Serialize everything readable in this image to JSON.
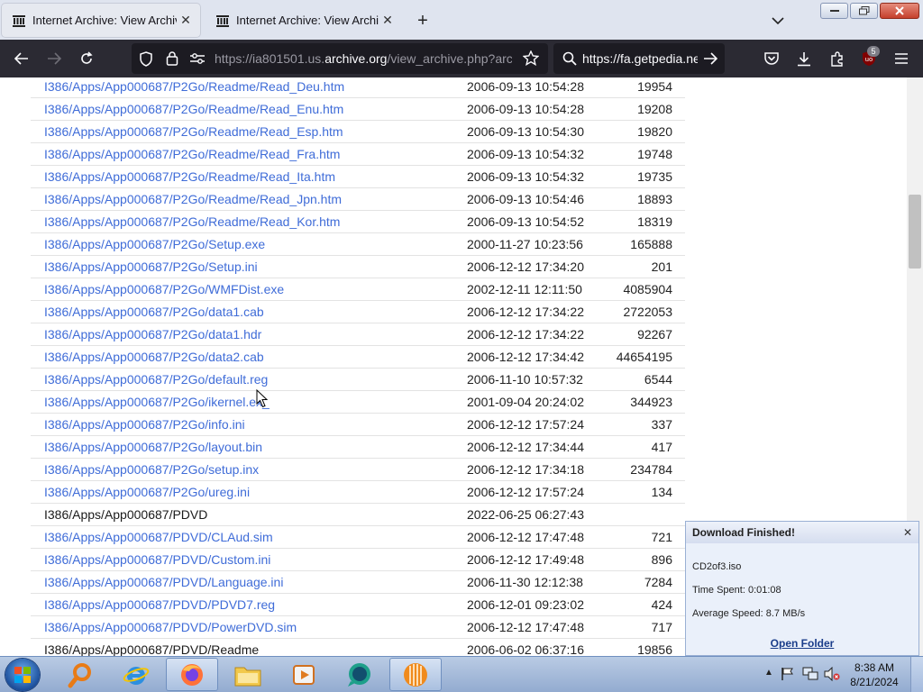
{
  "browser": {
    "tabs": [
      {
        "title": "Internet Archive: View Archive",
        "active": true
      },
      {
        "title": "Internet Archive: View Archive",
        "active": false
      }
    ],
    "url_host_prefix": "https://ia801501.us.",
    "url_host_main": "archive.org",
    "url_path": "/view_archive.php?archi",
    "search_text": "https://fa.getpedia.ne",
    "extension_badge": "5"
  },
  "files": [
    {
      "name": "I386/Apps/App000687/P2Go/Readme/Read_Deu.htm",
      "date": "2006-09-13 10:54:28",
      "size": "19954",
      "link": true
    },
    {
      "name": "I386/Apps/App000687/P2Go/Readme/Read_Enu.htm",
      "date": "2006-09-13 10:54:28",
      "size": "19208",
      "link": true
    },
    {
      "name": "I386/Apps/App000687/P2Go/Readme/Read_Esp.htm",
      "date": "2006-09-13 10:54:30",
      "size": "19820",
      "link": true
    },
    {
      "name": "I386/Apps/App000687/P2Go/Readme/Read_Fra.htm",
      "date": "2006-09-13 10:54:32",
      "size": "19748",
      "link": true
    },
    {
      "name": "I386/Apps/App000687/P2Go/Readme/Read_Ita.htm",
      "date": "2006-09-13 10:54:32",
      "size": "19735",
      "link": true
    },
    {
      "name": "I386/Apps/App000687/P2Go/Readme/Read_Jpn.htm",
      "date": "2006-09-13 10:54:46",
      "size": "18893",
      "link": true
    },
    {
      "name": "I386/Apps/App000687/P2Go/Readme/Read_Kor.htm",
      "date": "2006-09-13 10:54:52",
      "size": "18319",
      "link": true
    },
    {
      "name": "I386/Apps/App000687/P2Go/Setup.exe",
      "date": "2000-11-27 10:23:56",
      "size": "165888",
      "link": true
    },
    {
      "name": "I386/Apps/App000687/P2Go/Setup.ini",
      "date": "2006-12-12 17:34:20",
      "size": "201",
      "link": true
    },
    {
      "name": "I386/Apps/App000687/P2Go/WMFDist.exe",
      "date": "2002-12-11 12:11:50",
      "size": "4085904",
      "link": true
    },
    {
      "name": "I386/Apps/App000687/P2Go/data1.cab",
      "date": "2006-12-12 17:34:22",
      "size": "2722053",
      "link": true
    },
    {
      "name": "I386/Apps/App000687/P2Go/data1.hdr",
      "date": "2006-12-12 17:34:22",
      "size": "92267",
      "link": true
    },
    {
      "name": "I386/Apps/App000687/P2Go/data2.cab",
      "date": "2006-12-12 17:34:42",
      "size": "44654195",
      "link": true
    },
    {
      "name": "I386/Apps/App000687/P2Go/default.reg",
      "date": "2006-11-10 10:57:32",
      "size": "6544",
      "link": true
    },
    {
      "name": "I386/Apps/App000687/P2Go/ikernel.ex_",
      "date": "2001-09-04 20:24:02",
      "size": "344923",
      "link": true
    },
    {
      "name": "I386/Apps/App000687/P2Go/info.ini",
      "date": "2006-12-12 17:57:24",
      "size": "337",
      "link": true
    },
    {
      "name": "I386/Apps/App000687/P2Go/layout.bin",
      "date": "2006-12-12 17:34:44",
      "size": "417",
      "link": true
    },
    {
      "name": "I386/Apps/App000687/P2Go/setup.inx",
      "date": "2006-12-12 17:34:18",
      "size": "234784",
      "link": true
    },
    {
      "name": "I386/Apps/App000687/P2Go/ureg.ini",
      "date": "2006-12-12 17:57:24",
      "size": "134",
      "link": true
    },
    {
      "name": "I386/Apps/App000687/PDVD",
      "date": "2022-06-25 06:27:43",
      "size": "",
      "link": false
    },
    {
      "name": "I386/Apps/App000687/PDVD/CLAud.sim",
      "date": "2006-12-12 17:47:48",
      "size": "721",
      "link": true
    },
    {
      "name": "I386/Apps/App000687/PDVD/Custom.ini",
      "date": "2006-12-12 17:49:48",
      "size": "896",
      "link": true
    },
    {
      "name": "I386/Apps/App000687/PDVD/Language.ini",
      "date": "2006-11-30 12:12:38",
      "size": "7284",
      "link": true
    },
    {
      "name": "I386/Apps/App000687/PDVD/PDVD7.reg",
      "date": "2006-12-01 09:23:02",
      "size": "424",
      "link": true
    },
    {
      "name": "I386/Apps/App000687/PDVD/PowerDVD.sim",
      "date": "2006-12-12 17:47:48",
      "size": "717",
      "link": true
    },
    {
      "name": "I386/Apps/App000687/PDVD/Readme",
      "date": "2006-06-02 06:37:16",
      "size": "19856",
      "link": false
    }
  ],
  "download_popup": {
    "title": "Download Finished!",
    "file": "CD2of3.iso",
    "time_spent": "Time Spent: 0:01:08",
    "average_speed": "Average Speed: 8.7 MB/s",
    "open_folder": "Open Folder"
  },
  "taskbar": {
    "time": "8:38 AM",
    "date": "8/21/2024"
  },
  "colors": {
    "link": "#3f6cd8",
    "nav_dark": "#2b2a33",
    "tabstrip": "#dfe4ef"
  }
}
